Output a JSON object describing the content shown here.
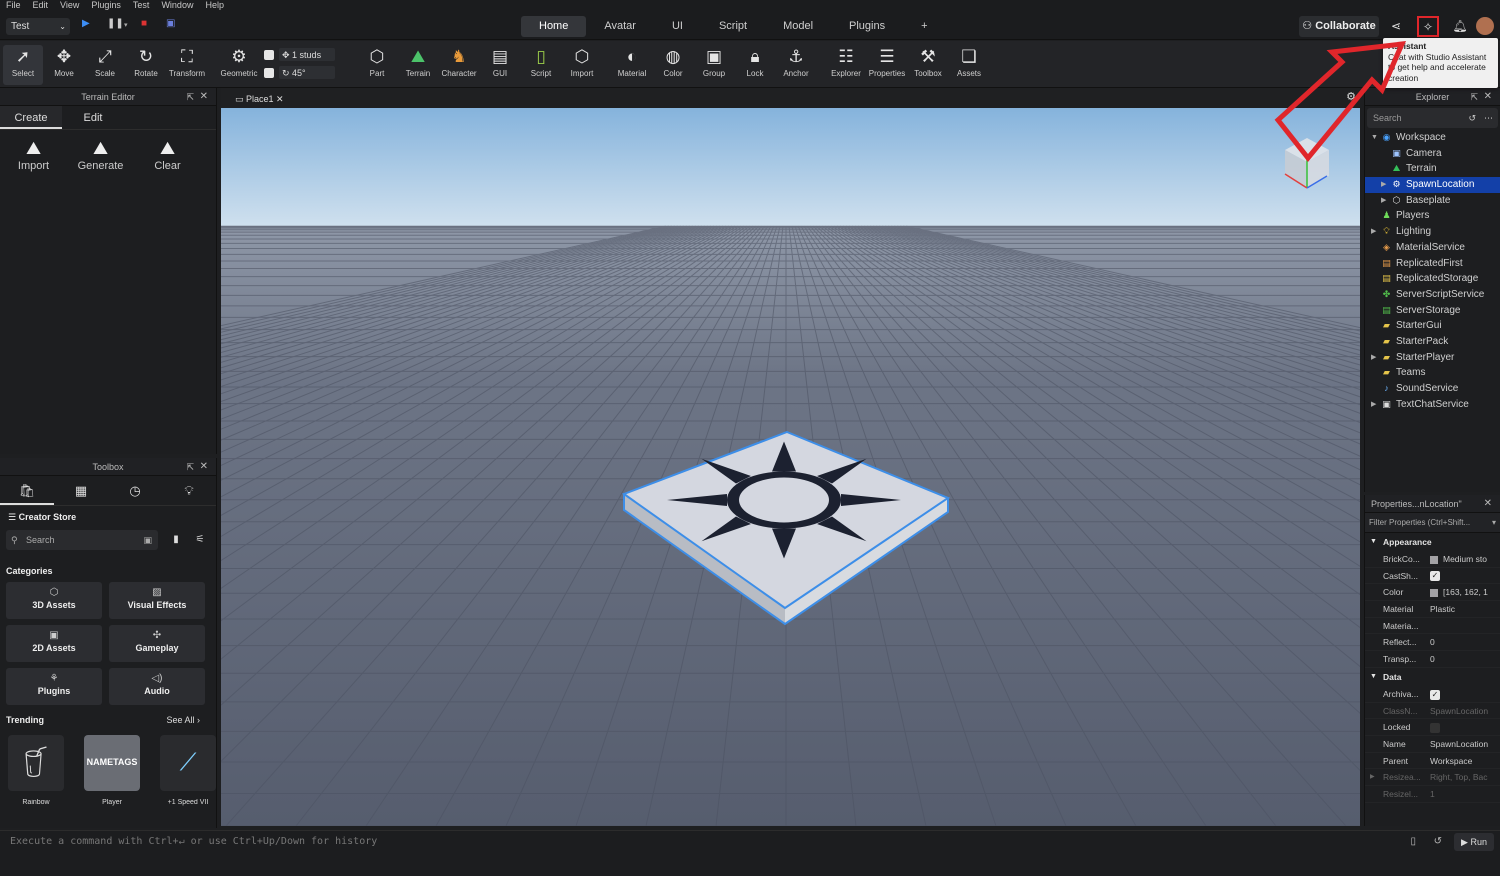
{
  "menu": [
    "File",
    "Edit",
    "View",
    "Plugins",
    "Test",
    "Window",
    "Help"
  ],
  "titlebar": {
    "mode": "Test",
    "tabs": [
      "Home",
      "Avatar",
      "UI",
      "Script",
      "Model",
      "Plugins"
    ],
    "add_tab": "+",
    "collaborate": "Collaborate"
  },
  "ribbon": {
    "tools": [
      "Select",
      "Move",
      "Scale",
      "Rotate",
      "Transform"
    ],
    "geometric": "Geometric",
    "snap_move": "1 studs",
    "snap_rotate": "45°",
    "insert": [
      "Part",
      "Terrain",
      "Character",
      "GUI",
      "Script",
      "Import"
    ],
    "edit": [
      "Material",
      "Color",
      "Group",
      "Lock",
      "Anchor"
    ],
    "windows": [
      "Explorer",
      "Properties",
      "Toolbox",
      "Assets"
    ]
  },
  "terrain_editor": {
    "title": "Terrain Editor",
    "tabs": [
      "Create",
      "Edit"
    ],
    "tools": [
      "Import",
      "Generate",
      "Clear"
    ]
  },
  "toolbox": {
    "title": "Toolbox",
    "store": "Creator Store",
    "search_placeholder": "Search",
    "categories_heading": "Categories",
    "categories": [
      "3D Assets",
      "Visual Effects",
      "2D Assets",
      "Gameplay",
      "Plugins",
      "Audio"
    ],
    "trending": "Trending",
    "see_all": "See All",
    "items": [
      "Rainbow",
      "Player",
      "+1 Speed VII"
    ],
    "item_art": "NAMETAGS"
  },
  "viewport": {
    "tab": "Place1"
  },
  "explorer": {
    "title": "Explorer",
    "search_placeholder": "Search",
    "rows": [
      {
        "name": "Workspace",
        "depth": 0,
        "expand": "open",
        "icon": "globe",
        "color": "#4aa3ff"
      },
      {
        "name": "Camera",
        "depth": 1,
        "expand": "",
        "icon": "cam",
        "color": "#9ec4ff"
      },
      {
        "name": "Terrain",
        "depth": 1,
        "expand": "",
        "icon": "terrain",
        "color": "#35c05a"
      },
      {
        "name": "SpawnLocation",
        "depth": 1,
        "expand": "closed",
        "icon": "spawn",
        "color": "#ffffff",
        "selected": true
      },
      {
        "name": "Baseplate",
        "depth": 1,
        "expand": "closed",
        "icon": "part",
        "color": "#dddddd"
      },
      {
        "name": "Players",
        "depth": 0,
        "expand": "",
        "icon": "players",
        "color": "#6fdc5a"
      },
      {
        "name": "Lighting",
        "depth": 0,
        "expand": "closed",
        "icon": "bulb",
        "color": "#ffd43a"
      },
      {
        "name": "MaterialService",
        "depth": 0,
        "expand": "",
        "icon": "mat",
        "color": "#e59b4a"
      },
      {
        "name": "ReplicatedFirst",
        "depth": 0,
        "expand": "",
        "icon": "rep",
        "color": "#e59b4a"
      },
      {
        "name": "ReplicatedStorage",
        "depth": 0,
        "expand": "",
        "icon": "rep",
        "color": "#e5c44a"
      },
      {
        "name": "ServerScriptService",
        "depth": 0,
        "expand": "",
        "icon": "ss",
        "color": "#52c04c"
      },
      {
        "name": "ServerStorage",
        "depth": 0,
        "expand": "",
        "icon": "sst",
        "color": "#52c04c"
      },
      {
        "name": "StarterGui",
        "depth": 0,
        "expand": "",
        "icon": "folder",
        "color": "#e5c44a"
      },
      {
        "name": "StarterPack",
        "depth": 0,
        "expand": "",
        "icon": "folder",
        "color": "#e5c44a"
      },
      {
        "name": "StarterPlayer",
        "depth": 0,
        "expand": "closed",
        "icon": "folder",
        "color": "#e5c44a"
      },
      {
        "name": "Teams",
        "depth": 0,
        "expand": "",
        "icon": "folder",
        "color": "#e5c44a"
      },
      {
        "name": "SoundService",
        "depth": 0,
        "expand": "",
        "icon": "sound",
        "color": "#6fb6ff"
      },
      {
        "name": "TextChatService",
        "depth": 0,
        "expand": "closed",
        "icon": "chat",
        "color": "#dddddd"
      }
    ]
  },
  "properties": {
    "title": "Properties...nLocation\"",
    "filter": "Filter Properties (Ctrl+Shift...",
    "sections": [
      {
        "name": "Appearance",
        "rows": [
          {
            "key": "BrickCo...",
            "value": "Medium sto",
            "swatch": "#a3a2a5"
          },
          {
            "key": "CastSh...",
            "check": true
          },
          {
            "key": "Color",
            "value": "[163, 162, 1",
            "swatch": "#a3a2a5"
          },
          {
            "key": "Material",
            "value": "Plastic"
          },
          {
            "key": "Materia...",
            "value": ""
          },
          {
            "key": "Reflect...",
            "value": "0"
          },
          {
            "key": "Transp...",
            "value": "0"
          }
        ]
      },
      {
        "name": "Data",
        "rows": [
          {
            "key": "Archiva...",
            "check": true
          },
          {
            "key": "ClassN...",
            "value": "SpawnLocation",
            "dim": true
          },
          {
            "key": "Locked",
            "check": false
          },
          {
            "key": "Name",
            "value": "SpawnLocation"
          },
          {
            "key": "Parent",
            "value": "Workspace"
          },
          {
            "key": "Resizea...",
            "value": "Right, Top, Bac",
            "dim": true,
            "expand": true
          },
          {
            "key": "Resizel...",
            "value": "1",
            "dim": true
          }
        ]
      }
    ]
  },
  "command": {
    "placeholder": "Execute a command with Ctrl+↵ or use Ctrl+Up/Down for history",
    "run": "Run"
  },
  "tooltip": {
    "title": "Assistant",
    "body": "Chat with Studio Assistant to get help and accelerate creation"
  },
  "colors": {
    "accent": "#1340a8",
    "annotation": "#e0262b",
    "sky_top": "#87b4dc",
    "sky_bottom": "#c8dced",
    "ground": "#5b6273"
  }
}
